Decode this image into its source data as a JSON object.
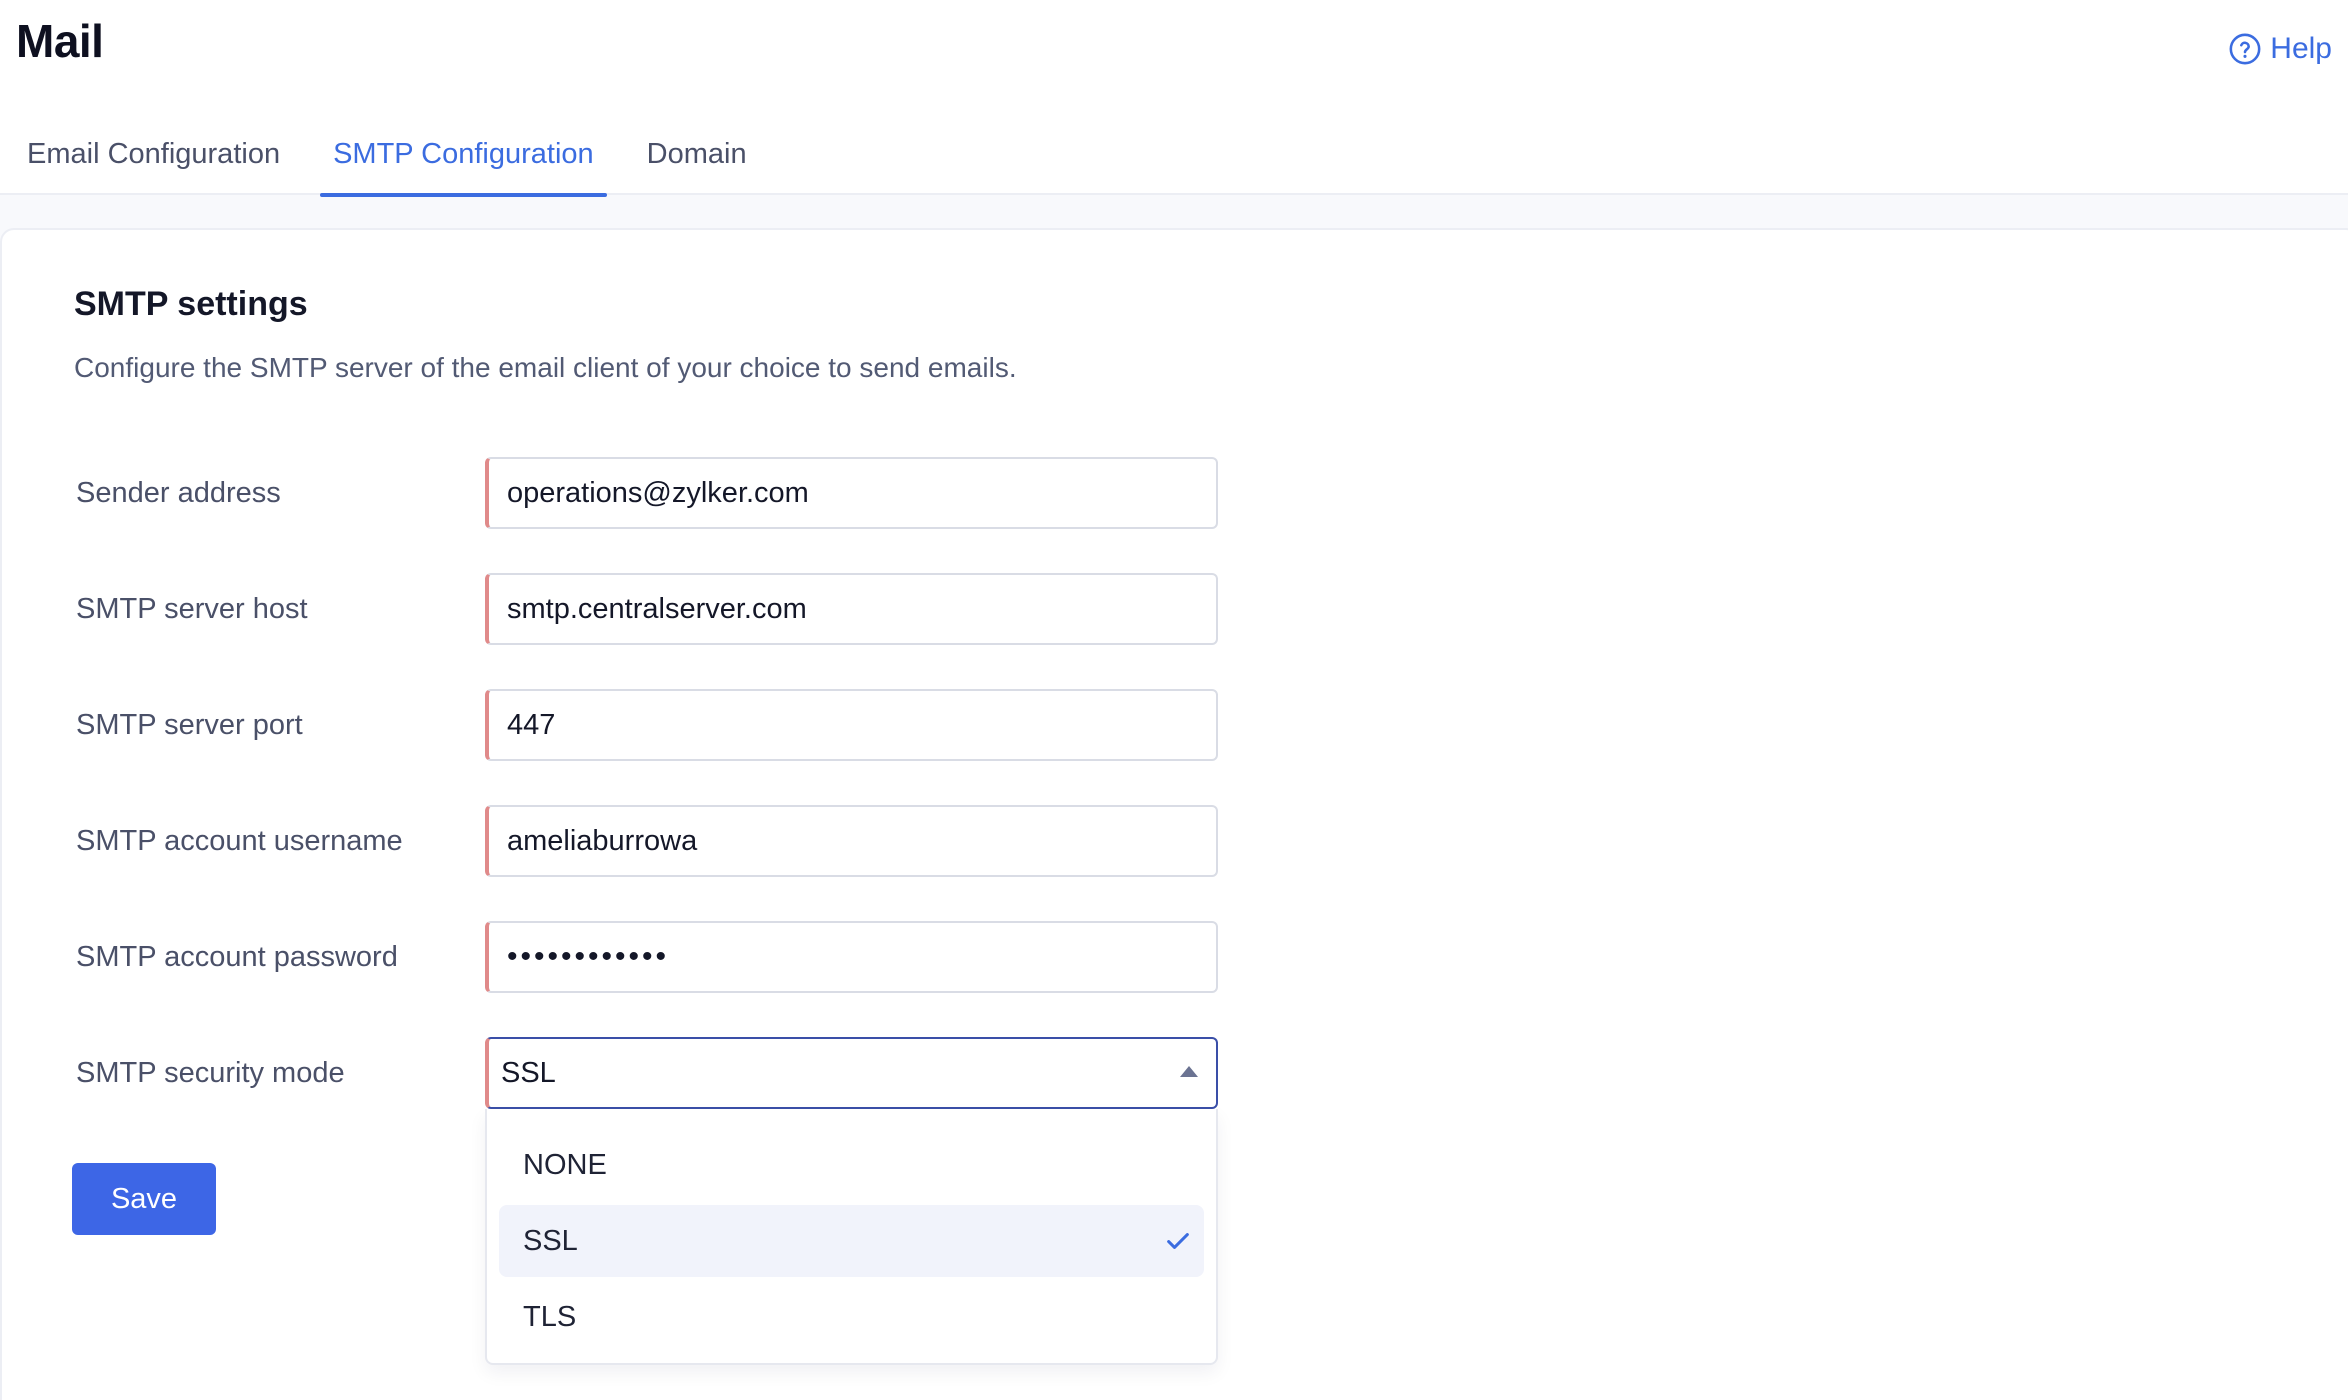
{
  "app": {
    "title": "Mail",
    "help_label": "Help"
  },
  "tabs": [
    {
      "label": "Email Configuration",
      "active": false
    },
    {
      "label": "SMTP Configuration",
      "active": true
    },
    {
      "label": "Domain",
      "active": false
    }
  ],
  "section": {
    "title": "SMTP settings",
    "description": "Configure the SMTP server of the email client of your choice to send emails."
  },
  "fields": {
    "sender_address": {
      "label": "Sender address",
      "value": "operations@zylker.com"
    },
    "server_host": {
      "label": "SMTP server host",
      "value": "smtp.centralserver.com"
    },
    "server_port": {
      "label": "SMTP server port",
      "value": "447"
    },
    "username": {
      "label": "SMTP account username",
      "value": "ameliaburrowa"
    },
    "password": {
      "label": "SMTP account password",
      "value": "••••••••••••"
    },
    "security_mode": {
      "label": "SMTP security mode",
      "value": "SSL",
      "options": [
        "NONE",
        "SSL",
        "TLS"
      ]
    }
  },
  "actions": {
    "save_label": "Save"
  },
  "colors": {
    "accent": "#3b6ce0",
    "required_marker": "#e08a8a",
    "button_bg": "#3d66e6"
  }
}
